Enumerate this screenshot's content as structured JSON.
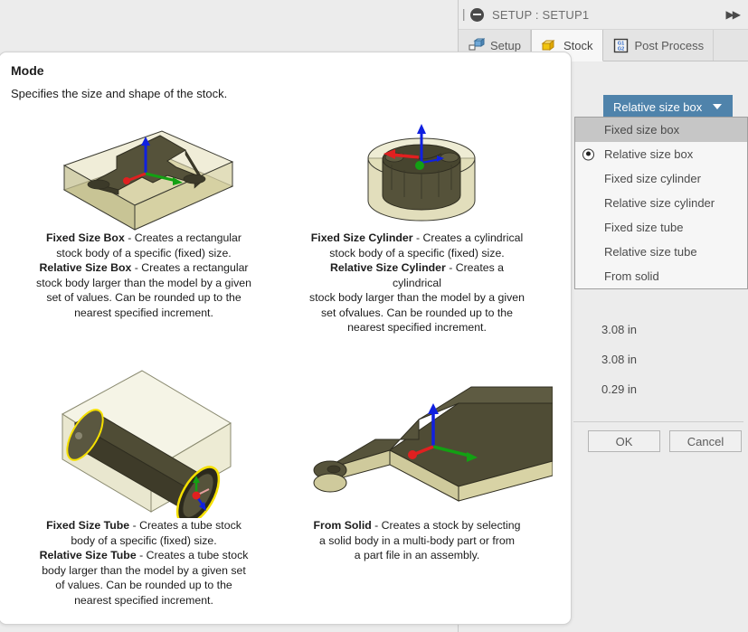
{
  "dialog": {
    "title": "SETUP : SETUP1",
    "collapse_icon": "minus-circle-icon",
    "expand_icon": "▶▶",
    "tabs": [
      {
        "label": "Setup",
        "icon": "setup-icon",
        "active": false
      },
      {
        "label": "Stock",
        "icon": "stock-box-icon",
        "active": true
      },
      {
        "label": "Post Process",
        "icon": "post-process-g1g2-icon",
        "active": false
      }
    ],
    "combo": {
      "value": "Relative size box",
      "caret_icon": "chevron-down-icon"
    },
    "dropdown_options": [
      {
        "label": "Fixed size box",
        "highlighted": true,
        "selected": false
      },
      {
        "label": "Relative size box",
        "highlighted": false,
        "selected": true
      },
      {
        "label": "Fixed size cylinder",
        "highlighted": false,
        "selected": false
      },
      {
        "label": "Relative size cylinder",
        "highlighted": false,
        "selected": false
      },
      {
        "label": "Fixed size tube",
        "highlighted": false,
        "selected": false
      },
      {
        "label": "Relative size tube",
        "highlighted": false,
        "selected": false
      },
      {
        "label": "From solid",
        "highlighted": false,
        "selected": false
      }
    ],
    "measurements": [
      "3.08 in",
      "3.08 in",
      "0.29 in"
    ],
    "buttons": {
      "ok": "OK",
      "cancel": "Cancel"
    }
  },
  "tooltip": {
    "title": "Mode",
    "subtitle": "Specifies the size and shape of the stock.",
    "cells": [
      {
        "image": "stock-box-3d-illustration",
        "caption_lines": [
          {
            "bold": "Fixed Size Box",
            "rest": " - Creates a rectangular"
          },
          {
            "bold": "",
            "rest": "stock body of a specific (fixed) size."
          },
          {
            "bold": "Relative Size Box",
            "rest": " - Creates a rectangular"
          },
          {
            "bold": "",
            "rest": "stock body larger than the model by a given"
          },
          {
            "bold": "",
            "rest": "set of values. Can be rounded up to the"
          },
          {
            "bold": "",
            "rest": "nearest specified increment."
          }
        ]
      },
      {
        "image": "stock-cylinder-3d-illustration",
        "caption_lines": [
          {
            "bold": "Fixed Size Cylinder",
            "rest": " - Creates a cylindrical"
          },
          {
            "bold": "",
            "rest": "stock body of a specific (fixed) size."
          },
          {
            "bold": "Relative Size Cylinder",
            "rest": " - Creates a"
          },
          {
            "bold": "",
            "rest": "cylindrical"
          },
          {
            "bold": "",
            "rest": "stock body larger than the model by a given"
          },
          {
            "bold": "",
            "rest": "set ofvalues. Can be rounded up to the"
          },
          {
            "bold": "",
            "rest": "nearest specified increment."
          }
        ]
      },
      {
        "image": "stock-tube-3d-illustration",
        "caption_lines": [
          {
            "bold": "Fixed Size Tube",
            "rest": " - Creates a tube stock"
          },
          {
            "bold": "",
            "rest": "body of a specific (fixed) size."
          },
          {
            "bold": "Relative Size Tube",
            "rest": " - Creates a tube stock"
          },
          {
            "bold": "",
            "rest": "body larger than the model by a given set"
          },
          {
            "bold": "",
            "rest": "of values. Can be rounded up to the"
          },
          {
            "bold": "",
            "rest": "nearest specified increment."
          }
        ]
      },
      {
        "image": "stock-from-solid-3d-illustration",
        "caption_lines": [
          {
            "bold": "From Solid",
            "rest": " - Creates a stock by selecting"
          },
          {
            "bold": "",
            "rest": "a solid body in a multi-body part or from"
          },
          {
            "bold": "",
            "rest": "a part file in an assembly."
          }
        ]
      }
    ]
  },
  "colors": {
    "accent_blue": "#4f83ab",
    "panel_bg": "#ececec",
    "tooltip_bg": "#ffffff",
    "highlight_gray": "#c6c6c6",
    "stock_body": "#d6d2a8",
    "model_body": "#4a472d",
    "axis_x": "#e02020",
    "axis_y": "#13a013",
    "axis_z": "#1020e0",
    "tube_highlight": "#f5e000"
  }
}
